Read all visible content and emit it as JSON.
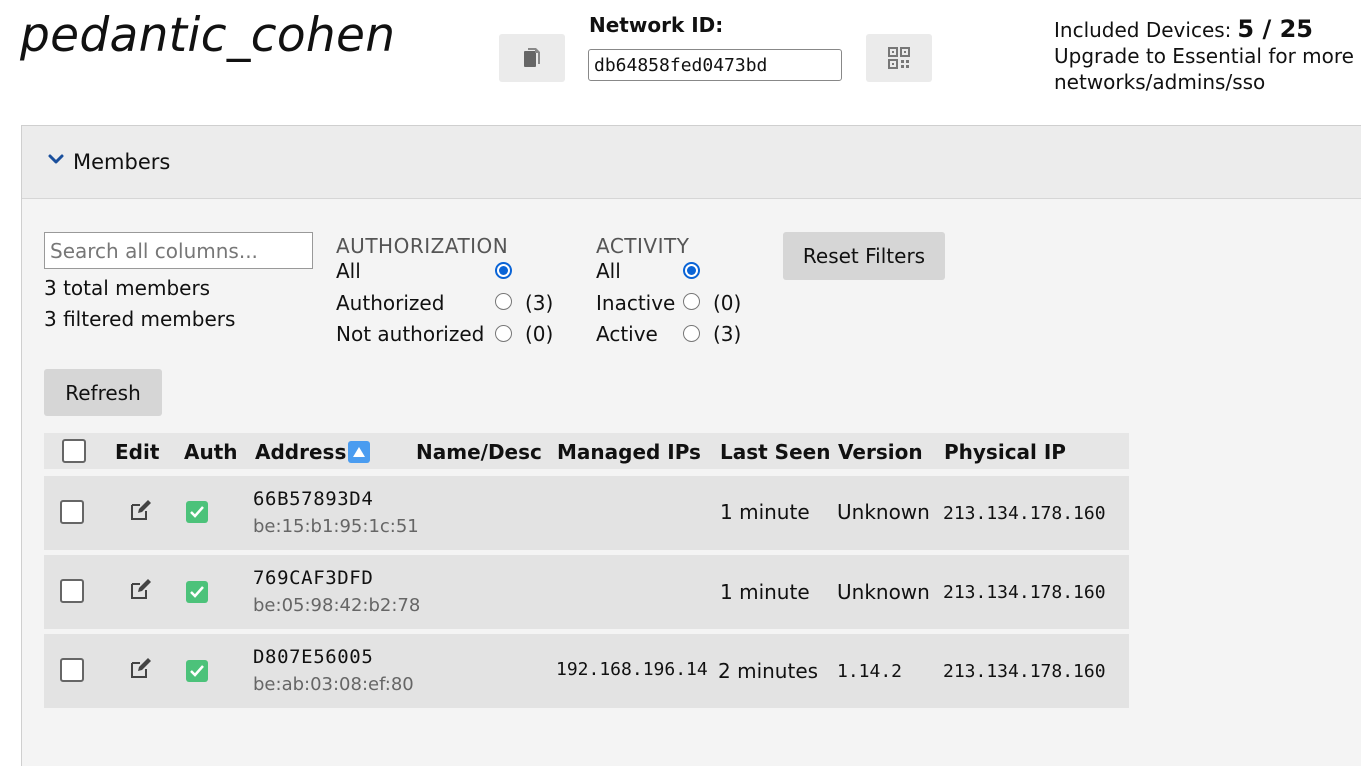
{
  "network": {
    "name": "pedantic_cohen",
    "id_label": "Network ID:",
    "id_value": "db64858fed0473bd"
  },
  "plan": {
    "included_label": "Included Devices:",
    "included_value": "5 / 25",
    "upgrade_line1": "Upgrade to Essential for more c",
    "upgrade_line2": "networks/admins/sso"
  },
  "members": {
    "title": "Members",
    "search_placeholder": "Search all columns...",
    "total": "3 total members",
    "filtered": "3 filtered members",
    "refresh": "Refresh",
    "reset": "Reset Filters"
  },
  "filters": {
    "authorization": {
      "title": "AUTHORIZATION",
      "options": [
        {
          "label": "All",
          "count": "",
          "selected": true
        },
        {
          "label": "Authorized",
          "count": "(3)",
          "selected": false
        },
        {
          "label": "Not authorized",
          "count": "(0)",
          "selected": false
        }
      ]
    },
    "activity": {
      "title": "ACTIVITY",
      "options": [
        {
          "label": "All",
          "count": "",
          "selected": true
        },
        {
          "label": "Inactive",
          "count": "(0)",
          "selected": false
        },
        {
          "label": "Active",
          "count": "(3)",
          "selected": false
        }
      ]
    }
  },
  "table": {
    "columns": [
      "Edit",
      "Auth",
      "Address",
      "Name/Desc",
      "Managed IPs",
      "Last Seen",
      "Version",
      "Physical IP"
    ],
    "rows": [
      {
        "address": "66B57893D4",
        "mac": "be:15:b1:95:1c:51",
        "name": "",
        "managed_ip": "",
        "last_seen": "1 minute",
        "version": "Unknown",
        "physical_ip": "213.134.178.160"
      },
      {
        "address": "769CAF3DFD",
        "mac": "be:05:98:42:b2:78",
        "name": "",
        "managed_ip": "",
        "last_seen": "1 minute",
        "version": "Unknown",
        "physical_ip": "213.134.178.160"
      },
      {
        "address": "D807E56005",
        "mac": "be:ab:03:08:ef:80",
        "name": "",
        "managed_ip": "192.168.196.14",
        "last_seen": "2 minutes",
        "version": "1.14.2",
        "physical_ip": "213.134.178.160"
      }
    ]
  },
  "colors": {
    "accent": "#0a64d6",
    "auth_green": "#4cc27a",
    "sort_blue": "#4a9cf0"
  },
  "icons": [
    "copy-icon",
    "qr-code-icon",
    "chevron-down-icon",
    "sort-ascending-icon",
    "edit-icon",
    "checkmark-icon"
  ]
}
